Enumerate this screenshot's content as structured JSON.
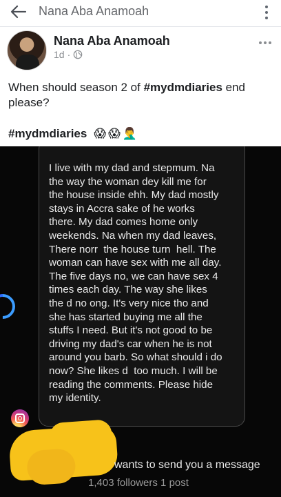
{
  "topbar": {
    "title": "Nana Aba Anamoah"
  },
  "post": {
    "author": "Nana Aba Anamoah",
    "time": "1d",
    "meta_separator": "·",
    "text_before": "When should season 2 of ",
    "text_hashtag": "#mydmdiaries",
    "text_after": " end please?",
    "hashtag_line": "#mydmdiaries",
    "emojis": [
      "😱",
      "😱",
      "🤦‍♂️"
    ]
  },
  "image": {
    "message": "I live with my dad and stepmum. Na\nthe way the woman dey kill me for\nthe house inside ehh. My dad mostly\nstays in Accra sake of he works\nthere. My dad comes home only\nweekends. Na when my dad leaves,\nThere norr  the house turn  hell. The\nwoman can have sex with me all day.\nThe five days no, we can have sex 4\ntimes each day. The way she likes\nthe d no ong. It's very nice tho and\nshe has started buying me all the\nstuffs I need. But it's not good to be\ndriving my dad's car when he is not\naround you barb. So what should i do\nnow? She likes d  too much. I will be\nreading the comments. Please hide\nmy identity.",
    "request_text": "wants to send you a message",
    "followers_text": "1,403 followers 1 post"
  },
  "colors": {
    "accent_blue": "#3b9cff",
    "scribble_yellow": "#f7c21a",
    "photo_bg": "#070707"
  }
}
